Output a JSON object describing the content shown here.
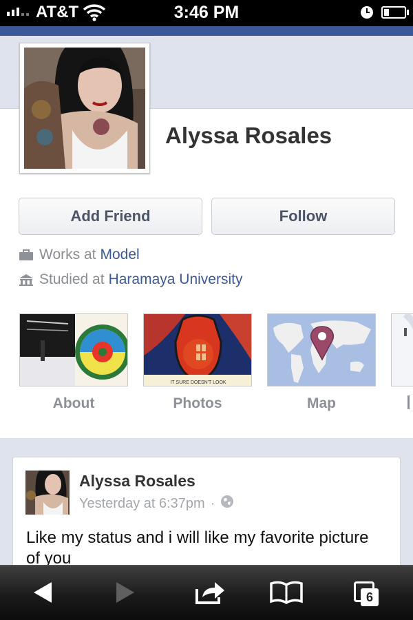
{
  "status_bar": {
    "carrier": "AT&T",
    "time": "3:46 PM",
    "battery_level": 0.25
  },
  "profile": {
    "name": "Alyssa Rosales",
    "add_friend_label": "Add Friend",
    "follow_label": "Follow",
    "work_prefix": "Works at",
    "work_place": "Model",
    "study_prefix": "Studied at",
    "school": "Haramaya University"
  },
  "tiles": [
    {
      "label": "About"
    },
    {
      "label": "Photos"
    },
    {
      "label": "Map"
    }
  ],
  "photo_caption": "IT SURE DOESN'T LOOK",
  "post": {
    "author": "Alyssa Rosales",
    "time": "Yesterday at 6:37pm",
    "separator": "·",
    "text": "Like my status and i will like my favorite picture of you"
  },
  "toolbar": {
    "tabs_count": "6"
  },
  "colors": {
    "facebook_blue": "#3b5998",
    "link": "#3b5998",
    "cover": "#dfe3ee"
  }
}
